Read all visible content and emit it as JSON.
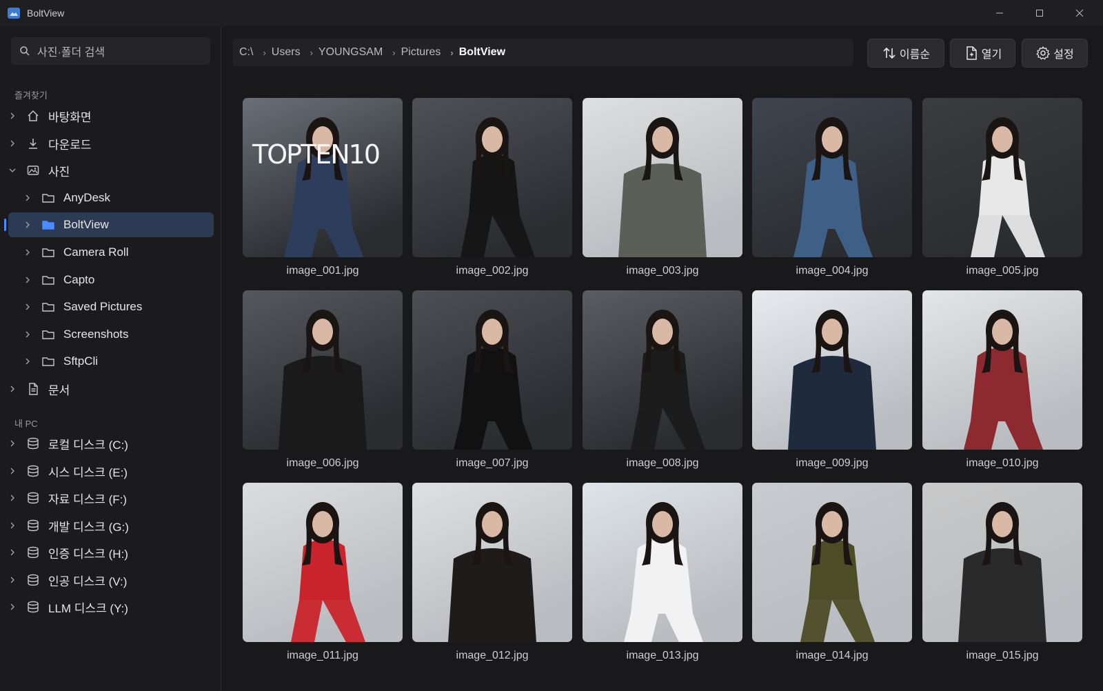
{
  "window": {
    "title": "BoltView"
  },
  "sidebar": {
    "search_placeholder": "사진·폴더 검색",
    "favorites_label": "즐겨찾기",
    "favorites": [
      {
        "label": "바탕화면",
        "icon": "home-icon",
        "expanded": false
      },
      {
        "label": "다운로드",
        "icon": "download-icon",
        "expanded": false
      },
      {
        "label": "사진",
        "icon": "image-icon",
        "expanded": true
      },
      {
        "label": "AnyDesk",
        "icon": "folder-icon"
      },
      {
        "label": "BoltView",
        "icon": "folder-icon",
        "selected": true
      },
      {
        "label": "Camera Roll",
        "icon": "folder-icon"
      },
      {
        "label": "Capto",
        "icon": "folder-icon"
      },
      {
        "label": "Saved Pictures",
        "icon": "folder-icon"
      },
      {
        "label": "Screenshots",
        "icon": "folder-icon"
      },
      {
        "label": "SftpCli",
        "icon": "folder-icon"
      },
      {
        "label": "문서",
        "icon": "document-icon"
      }
    ],
    "pc_label": "내 PC",
    "drives": [
      {
        "label": "로컬 디스크 (C:)"
      },
      {
        "label": "시스 디스크 (E:)"
      },
      {
        "label": "자료 디스크 (F:)"
      },
      {
        "label": "개발 디스크 (G:)"
      },
      {
        "label": "인증 디스크 (H:)"
      },
      {
        "label": "인공 디스크 (V:)"
      },
      {
        "label": "LLM 디스크 (Y:)"
      }
    ]
  },
  "breadcrumb": [
    "C:\\",
    "Users",
    "YOUNGSAM",
    "Pictures",
    "BoltView"
  ],
  "toolbar": {
    "sort_label": "이름순",
    "open_label": "열기",
    "settings_label": "설정"
  },
  "thumb_watermark": "TOPTEN10",
  "images": [
    {
      "name": "image_001.jpg",
      "bg": "#6a6f78",
      "fg": "#2c3e5c"
    },
    {
      "name": "image_002.jpg",
      "bg": "#4e5157",
      "fg": "#151515"
    },
    {
      "name": "image_003.jpg",
      "bg": "#dedfe1",
      "fg": "#5b5f58"
    },
    {
      "name": "image_004.jpg",
      "bg": "#3f4550",
      "fg": "#3e5f86"
    },
    {
      "name": "image_005.jpg",
      "bg": "#3a3c40",
      "fg": "#e8e8e8"
    },
    {
      "name": "image_006.jpg",
      "bg": "#55585e",
      "fg": "#1a1a1a"
    },
    {
      "name": "image_007.jpg",
      "bg": "#4c4f55",
      "fg": "#111112"
    },
    {
      "name": "image_008.jpg",
      "bg": "#5a5d63",
      "fg": "#1b1b1b"
    },
    {
      "name": "image_009.jpg",
      "bg": "#e7ebef",
      "fg": "#1f2b3d"
    },
    {
      "name": "image_010.jpg",
      "bg": "#e3e5e7",
      "fg": "#8d2a30"
    },
    {
      "name": "image_011.jpg",
      "bg": "#dcdde0",
      "fg": "#c9242b"
    },
    {
      "name": "image_012.jpg",
      "bg": "#dfe0e2",
      "fg": "#1f1b1a"
    },
    {
      "name": "image_013.jpg",
      "bg": "#dfe4ea",
      "fg": "#f2f2f2"
    },
    {
      "name": "image_014.jpg",
      "bg": "#c8cbcf",
      "fg": "#4c4d26"
    },
    {
      "name": "image_015.jpg",
      "bg": "#c9c9c9",
      "fg": "#2a2a2a"
    }
  ]
}
